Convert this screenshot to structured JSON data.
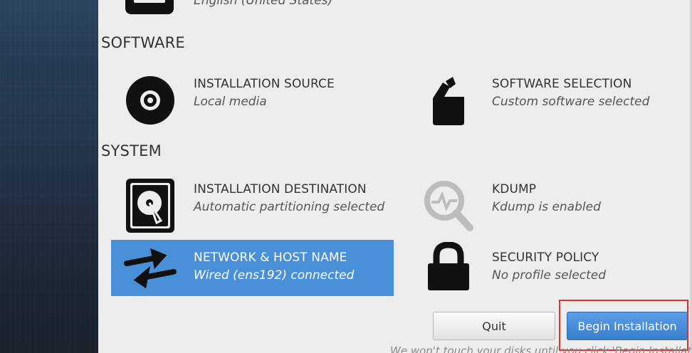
{
  "localization": {
    "partial_status": "English (United States)"
  },
  "sections": {
    "software": "SOFTWARE",
    "system": "SYSTEM"
  },
  "spokes": {
    "installation_source": {
      "title": "INSTALLATION SOURCE",
      "status": "Local media",
      "icon": "disc-icon"
    },
    "software_selection": {
      "title": "SOFTWARE SELECTION",
      "status": "Custom software selected",
      "icon": "package-icon"
    },
    "installation_destination": {
      "title": "INSTALLATION DESTINATION",
      "status": "Automatic partitioning selected",
      "icon": "hard-drive-icon"
    },
    "kdump": {
      "title": "KDUMP",
      "status": "Kdump is enabled",
      "icon": "magnifier-icon"
    },
    "network": {
      "title": "NETWORK & HOST NAME",
      "status": "Wired (ens192) connected",
      "icon": "network-arrows-icon"
    },
    "security_policy": {
      "title": "SECURITY POLICY",
      "status": "No profile selected",
      "icon": "padlock-icon"
    }
  },
  "buttons": {
    "quit": "Quit",
    "begin": "Begin Installation"
  },
  "footer": {
    "note": "We won't touch your disks until you click 'Begin Installation'."
  },
  "colors": {
    "accent": "#4a90d9",
    "highlight": "#e0302f",
    "background": "#ededed"
  }
}
